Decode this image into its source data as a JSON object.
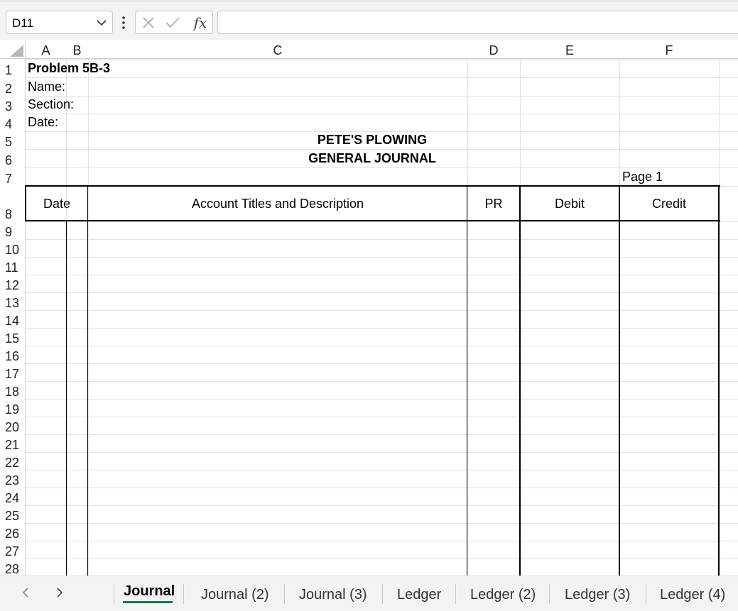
{
  "formula_bar": {
    "name_box": "D11",
    "formula": ""
  },
  "columns": [
    "A",
    "B",
    "C",
    "D",
    "E",
    "F"
  ],
  "rows": [
    "1",
    "2",
    "3",
    "4",
    "5",
    "6",
    "7",
    "8",
    "9",
    "10",
    "11",
    "12",
    "13",
    "14",
    "15",
    "16",
    "17",
    "18",
    "19",
    "20",
    "21",
    "22",
    "23",
    "24",
    "25",
    "26",
    "27",
    "28"
  ],
  "sheet": {
    "title": "Problem 5B-3",
    "name_label": "Name:",
    "section_label": "Section:",
    "date_label": "Date:",
    "company": "PETE'S PLOWING",
    "journal_title": "GENERAL JOURNAL",
    "page": "Page 1",
    "headers": {
      "date": "Date",
      "account": "Account Titles and Description",
      "pr": "PR",
      "debit": "Debit",
      "credit": "Credit"
    }
  },
  "tabs": [
    "Journal",
    "Journal (2)",
    "Journal (3)",
    "Ledger",
    "Ledger (2)",
    "Ledger (3)",
    "Ledger (4)"
  ],
  "active_tab": "Journal",
  "colors": {
    "accent": "#107c41",
    "gridline": "#e1e1e1",
    "header_border": "#cfcfcf"
  }
}
